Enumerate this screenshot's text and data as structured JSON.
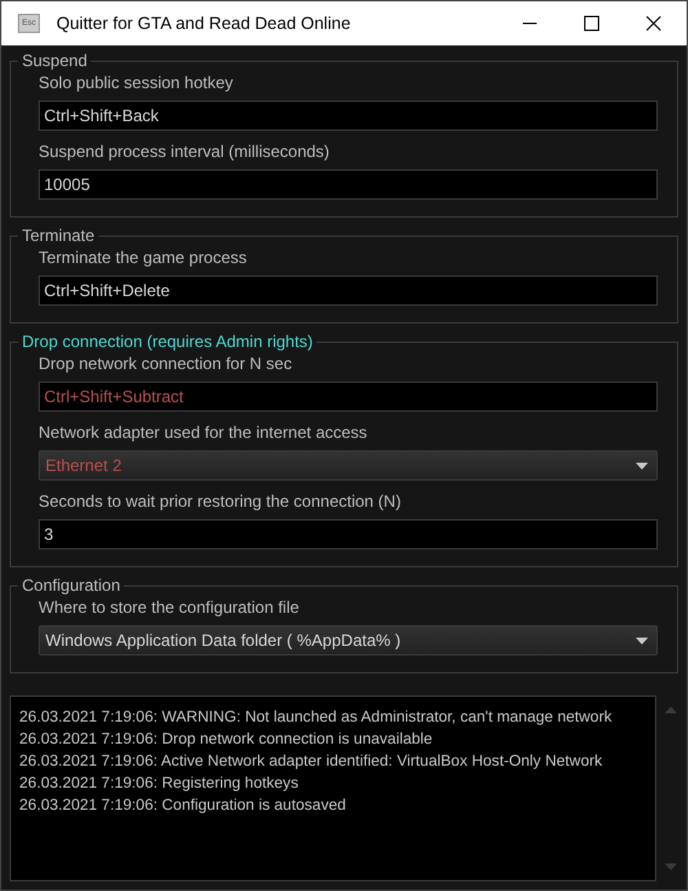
{
  "window": {
    "title": "Quitter for GTA and Read Dead Online",
    "icon_text": "Esc"
  },
  "groups": [
    {
      "title": "Suspend",
      "highlighted": false,
      "items": [
        {
          "kind": "field",
          "label": "Solo public session hotkey",
          "value": "Ctrl+Shift+Back",
          "error": false
        },
        {
          "kind": "field",
          "label": "Suspend process interval (milliseconds)",
          "value": "10005",
          "error": false
        }
      ]
    },
    {
      "title": "Terminate",
      "highlighted": false,
      "items": [
        {
          "kind": "field",
          "label": "Terminate the game process",
          "value": "Ctrl+Shift+Delete",
          "error": false
        }
      ]
    },
    {
      "title": "Drop connection (requires Admin rights)",
      "highlighted": true,
      "items": [
        {
          "kind": "field",
          "label": "Drop network connection for N sec",
          "value": "Ctrl+Shift+Subtract",
          "error": true
        },
        {
          "kind": "dropdown",
          "label": "Network adapter used for the internet access",
          "value": "Ethernet 2",
          "error": true
        },
        {
          "kind": "field",
          "label": "Seconds to wait prior restoring the connection (N)",
          "value": "3",
          "error": false
        }
      ]
    },
    {
      "title": "Configuration",
      "highlighted": false,
      "items": [
        {
          "kind": "dropdown",
          "label": "Where to store the configuration file",
          "value": "Windows Application Data folder ( %AppData% )",
          "error": false
        }
      ]
    }
  ],
  "log": [
    "26.03.2021 7:19:06: WARNING: Not launched as Administrator, can't manage network",
    "26.03.2021 7:19:06: Drop network connection is unavailable",
    "26.03.2021 7:19:06: Active Network adapter identified: VirtualBox Host-Only Network",
    "26.03.2021 7:19:06: Registering hotkeys",
    "26.03.2021 7:19:06: Configuration is autosaved"
  ]
}
